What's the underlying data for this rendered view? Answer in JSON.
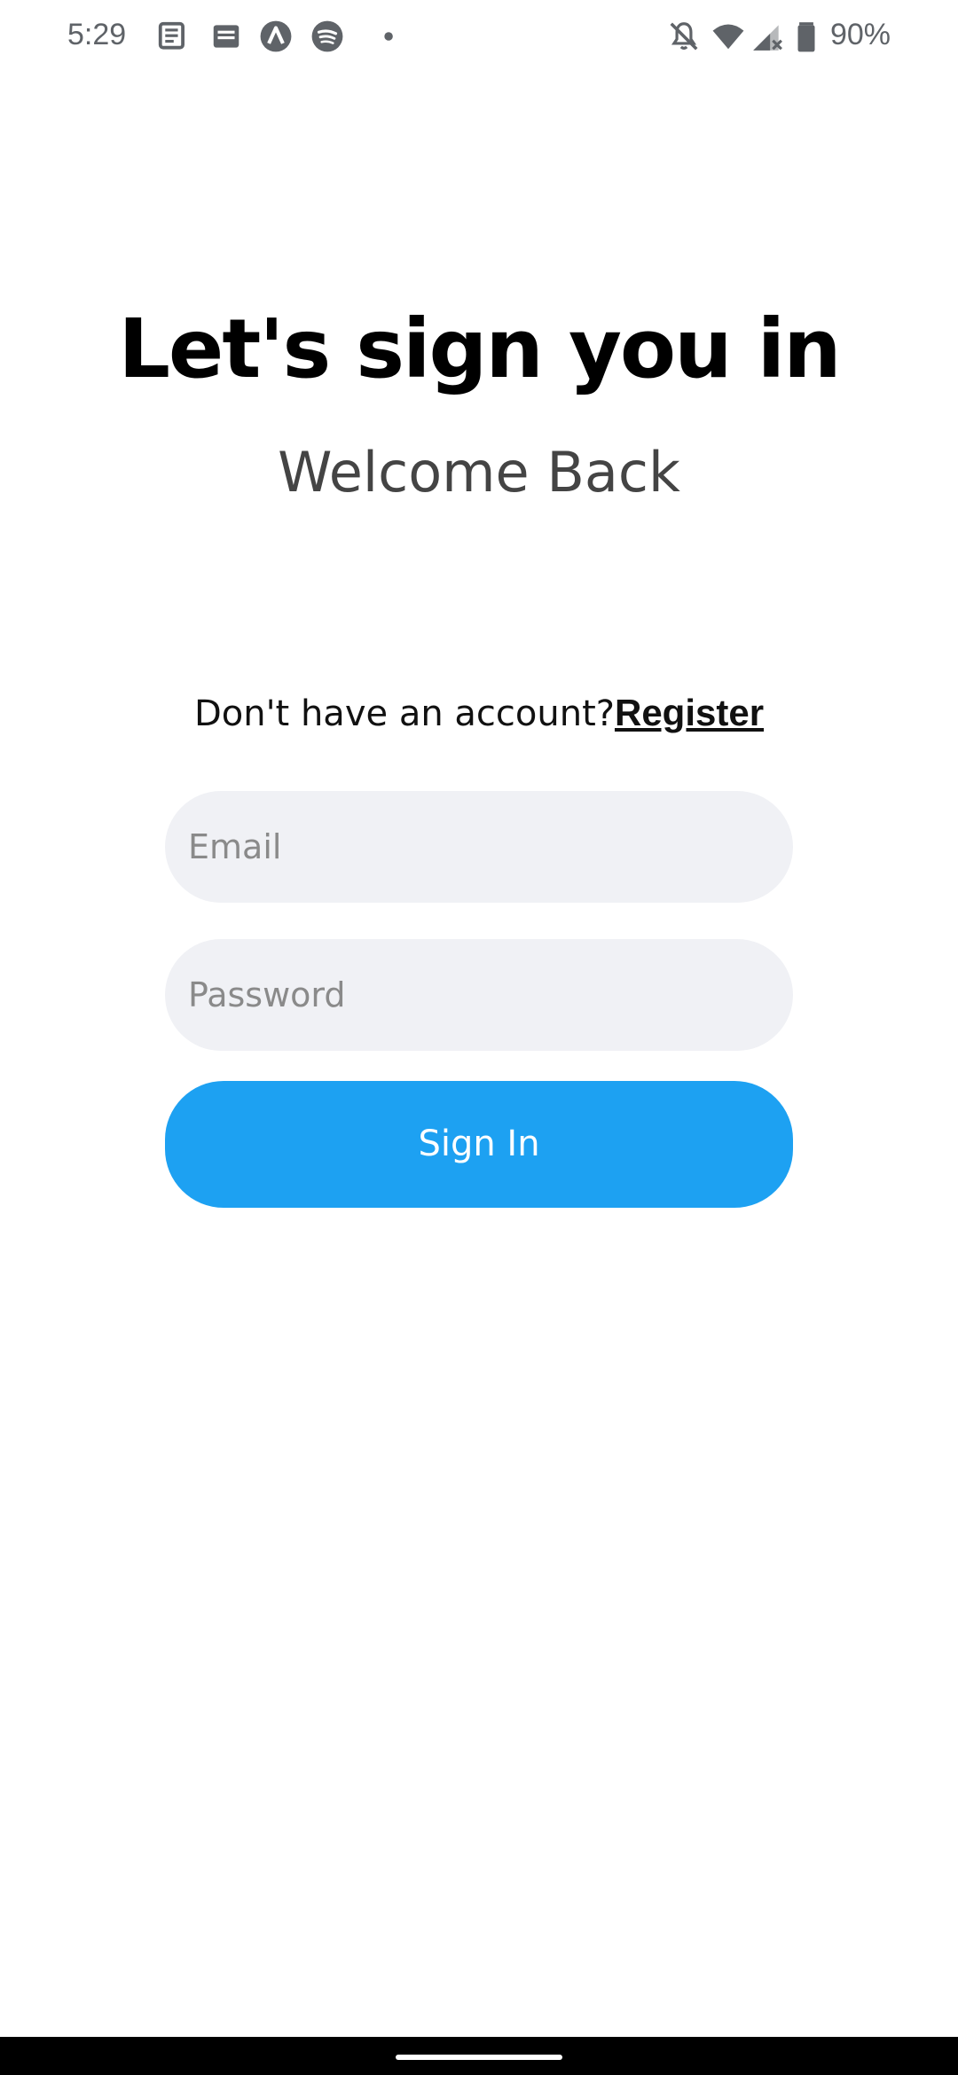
{
  "status_bar": {
    "time": "5:29",
    "battery_percent": "90%",
    "icons": [
      "news-icon",
      "news-icon",
      "arc-app-icon",
      "spotify-icon",
      "dot-icon",
      "bell-off-icon",
      "wifi-icon",
      "signal-icon",
      "battery-icon"
    ]
  },
  "header": {
    "title": "Let's sign you in",
    "subtitle": "Welcome Back"
  },
  "register": {
    "prompt": "Don't have an account?",
    "link_label": "Register"
  },
  "form": {
    "email": {
      "value": "",
      "placeholder": "Email"
    },
    "password": {
      "value": "",
      "placeholder": "Password"
    },
    "submit_label": "Sign In"
  },
  "colors": {
    "primary": "#1da1f2",
    "field_bg": "#f0f1f5",
    "title": "#000000",
    "subtitle": "#444444"
  }
}
